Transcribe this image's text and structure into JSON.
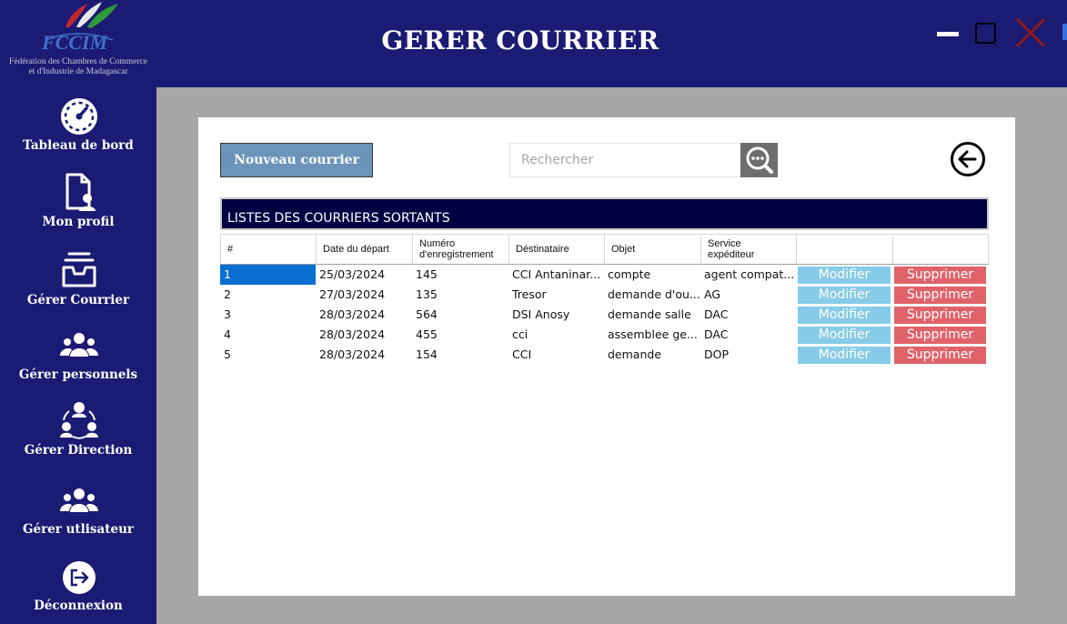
{
  "header": {
    "title": "GERER COURRIER",
    "logo_text_line1": "Fédération des Chambres de Commerce",
    "logo_text_line2": "et d'Industrie de Madagascar"
  },
  "window_controls": [
    "minimize-icon",
    "maximize-icon",
    "close-icon"
  ],
  "sidebar": {
    "items": [
      {
        "label": "Tableau de bord",
        "icon": "dashboard-gauge-icon"
      },
      {
        "label": "Mon profil",
        "icon": "profile-document-icon"
      },
      {
        "label": "Gérer Courrier",
        "icon": "inbox-tray-icon"
      },
      {
        "label": "Gérer personnels",
        "icon": "people-group-icon"
      },
      {
        "label": "Gérer Direction",
        "icon": "org-network-icon"
      },
      {
        "label": "Gérer utlisateur",
        "icon": "users-group-icon"
      },
      {
        "label": "Déconnexion",
        "icon": "logout-icon"
      }
    ]
  },
  "toolbar": {
    "new_button": "Nouveau courrier",
    "search_placeholder": "Rechercher",
    "search_icon": "search-icon",
    "back_icon": "back-arrow-icon"
  },
  "list": {
    "title": "LISTES DES COURRIERS SORTANTS",
    "columns": [
      {
        "label": "#"
      },
      {
        "label": "Date du départ"
      },
      {
        "label": "Numéro d'enregistrement"
      },
      {
        "label": "Déstinataire"
      },
      {
        "label": "Objet"
      },
      {
        "label": "Service expéditeur"
      },
      {
        "label": ""
      },
      {
        "label": ""
      }
    ],
    "rows": [
      {
        "id": "1",
        "date": "25/03/2024",
        "numero": "145",
        "destinataire": "CCI Antaninar...",
        "objet": "compte",
        "service": "agent compat...",
        "modifier": "Modifier",
        "supprimer": "Supprimer"
      },
      {
        "id": "2",
        "date": "27/03/2024",
        "numero": "135",
        "destinataire": "Tresor",
        "objet": "demande d'ou...",
        "service": "AG",
        "modifier": "Modifier",
        "supprimer": "Supprimer"
      },
      {
        "id": "3",
        "date": "28/03/2024",
        "numero": "564",
        "destinataire": "DSI Anosy",
        "objet": "demande salle",
        "service": "DAC",
        "modifier": "Modifier",
        "supprimer": "Supprimer"
      },
      {
        "id": "4",
        "date": "28/03/2024",
        "numero": "455",
        "destinataire": "cci",
        "objet": "assemblee ge...",
        "service": "DAC",
        "modifier": "Modifier",
        "supprimer": "Supprimer"
      },
      {
        "id": "5",
        "date": "28/03/2024",
        "numero": "154",
        "destinataire": "CCI",
        "objet": "demande",
        "service": "DOP",
        "modifier": "Modifier",
        "supprimer": "Supprimer"
      }
    ],
    "selected_row": "1"
  },
  "colors": {
    "sidebar_bg": "#1b1b73",
    "title_bar_bg": "#000042",
    "modifier_bg": "#87cbe8",
    "supprimer_bg": "#e0626a",
    "selection": "#0a6fd1"
  }
}
